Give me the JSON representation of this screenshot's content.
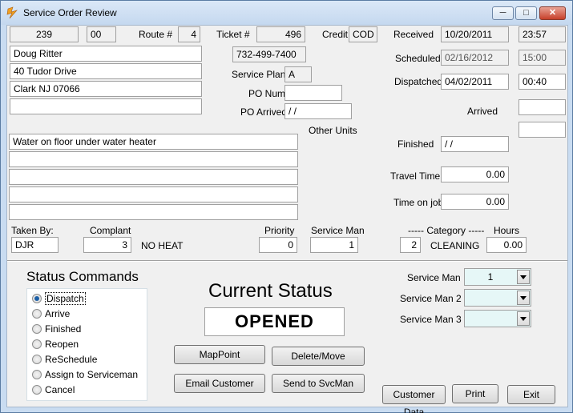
{
  "window": {
    "title": "Service Order Review"
  },
  "header": {
    "order_code": "239",
    "order_sub": "00",
    "route_label": "Route #",
    "route": "4",
    "ticket_label": "Ticket #",
    "ticket": "496",
    "credit_label": "Credit",
    "credit": "COD"
  },
  "customer": {
    "name": "Doug Ritter",
    "address1": "40 Tudor Drive",
    "address2": "Clark NJ  07066",
    "address3": "",
    "phone": "732-499-7400"
  },
  "service": {
    "plan_label": "Service Plan:",
    "plan": "A",
    "po_number_label": "PO Number",
    "po_number": "",
    "po_arrived_label": "PO Arrived",
    "po_arrived": " /  /",
    "other_units_label": "Other Units"
  },
  "times": {
    "received_label": "Received",
    "received_date": "10/20/2011",
    "received_time": "23:57",
    "scheduled_label": "Scheduled",
    "scheduled_date": "02/16/2012",
    "scheduled_time": "15:00",
    "dispatched_label": "Dispatched",
    "dispatched_date": "04/02/2011",
    "dispatched_time": "00:40",
    "arrived_label": "Arrived",
    "arrived_value": "",
    "arrived_extra": "",
    "finished_label": "Finished",
    "finished_date": " /  /",
    "travel_time_label": "Travel Time",
    "travel_time": "0.00",
    "time_on_job_label": "Time on job",
    "time_on_job": "0.00"
  },
  "problem_lines": [
    "Water on floor under water heater",
    "",
    "",
    "",
    ""
  ],
  "details": {
    "taken_by_label": "Taken By:",
    "taken_by": "DJR",
    "complaint_label": "Complant",
    "complaint_code": "3",
    "complaint_text": "NO HEAT",
    "priority_label": "Priority",
    "priority": "0",
    "service_man_label": "Service Man",
    "service_man": "1",
    "category_label": "----- Category -----",
    "category_code": "2",
    "category_text": "CLEANING",
    "hours_label": "Hours",
    "hours": "0.00"
  },
  "status_commands": {
    "title": "Status Commands",
    "options": [
      "Dispatch",
      "Arrive",
      "Finished",
      "Reopen",
      "ReSchedule",
      "Assign to Serviceman",
      "Cancel"
    ],
    "selected": "Dispatch"
  },
  "current_status": {
    "title": "Current Status",
    "value": "OPENED"
  },
  "buttons": {
    "mappoint": "MapPoint",
    "delete_move": "Delete/Move",
    "email_customer": "Email Customer",
    "send_to_svcman": "Send to SvcMan",
    "customer_data": "Customer Data",
    "print": "Print",
    "exit": "Exit"
  },
  "assign": {
    "service_man_label": "Service Man",
    "service_man": "1",
    "service_man2_label": "Service Man 2",
    "service_man2": "",
    "service_man3_label": "Service Man 3",
    "service_man3": ""
  }
}
